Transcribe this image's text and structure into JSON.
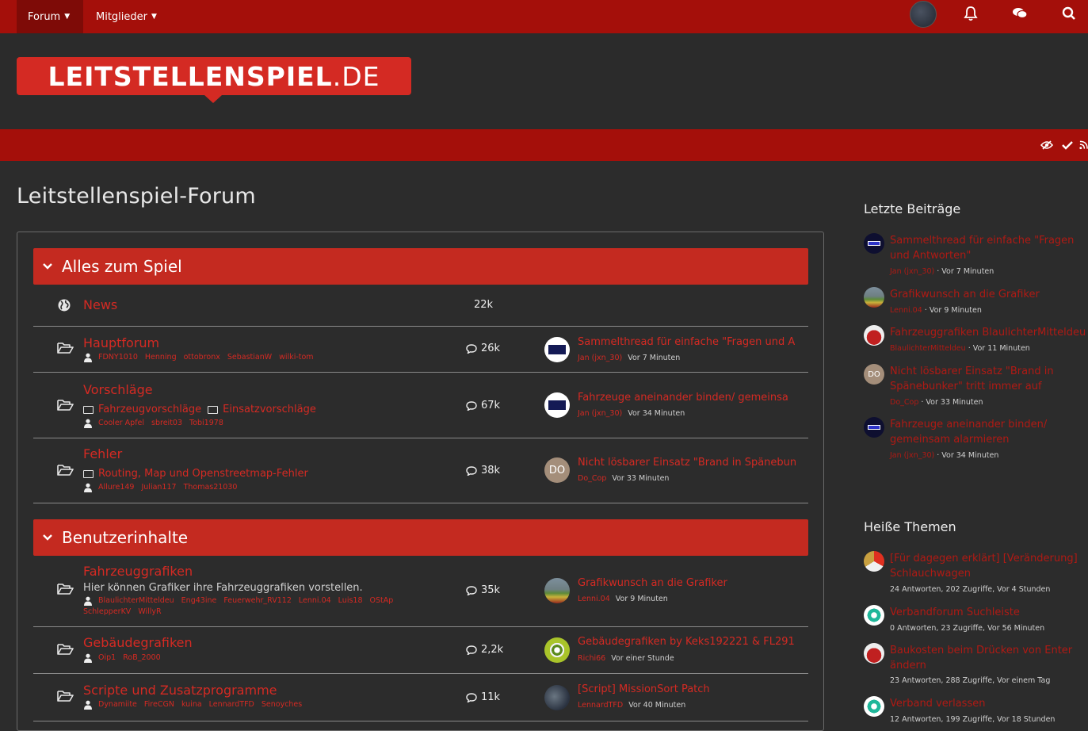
{
  "topnav": {
    "forum": "Forum",
    "members": "Mitglieder"
  },
  "logo": {
    "name": "LEITSTELLENSPIEL",
    "tld": ".DE"
  },
  "page_title": "Leitstellenspiel-Forum",
  "categories": [
    {
      "title": "Alles zum Spiel"
    },
    {
      "title": "Benutzerinhalte"
    }
  ],
  "forums": [
    {
      "title": "News",
      "count": "22k"
    },
    {
      "title": "Hauptforum",
      "mods": [
        "FDNY1010",
        "Henning",
        "ottobronx",
        "SebastianW",
        "wilki-tom"
      ],
      "count": "26k",
      "last_title": "Sammelthread für einfache \"Fragen und A",
      "last_user": "Jan (jxn_30)",
      "last_time": "Vor 7 Minuten"
    },
    {
      "title": "Vorschläge",
      "subs": [
        "Fahrzeugvorschläge",
        "Einsatzvorschläge"
      ],
      "mods": [
        "Cooler Apfel",
        "sbreit03",
        "Tobi1978"
      ],
      "count": "67k",
      "last_title": "Fahrzeuge aneinander binden/ gemeinsa",
      "last_user": "Jan (jxn_30)",
      "last_time": "Vor 34 Minuten"
    },
    {
      "title": "Fehler",
      "subs": [
        "Routing, Map und Openstreetmap-Fehler"
      ],
      "mods": [
        "Allure149",
        "Julian117",
        "Thomas21030"
      ],
      "count": "38k",
      "last_title": "Nicht lösbarer Einsatz \"Brand in Spänebun",
      "last_user": "Do_Cop",
      "last_time": "Vor 33 Minuten",
      "last_avatar": "DO"
    },
    {
      "title": "Fahrzeuggrafiken",
      "desc": "Hier können Grafiker ihre Fahrzeuggrafiken vorstellen.",
      "mods": [
        "BlaulichterMitteldeu",
        "Eng43ine",
        "Feuerwehr_RV112",
        "Lenni.04",
        "Luis18",
        "OStAp",
        "SchlepperKV",
        "WillyR"
      ],
      "count": "35k",
      "last_title": "Grafikwunsch an die Grafiker",
      "last_user": "Lenni.04",
      "last_time": "Vor 9 Minuten"
    },
    {
      "title": "Gebäudegrafiken",
      "mods": [
        "Oip1",
        "RoB_2000"
      ],
      "count": "2,2k",
      "last_title": "Gebäudegrafiken by Keks192221 & FL291",
      "last_user": "Richi66",
      "last_time": "Vor einer Stunde"
    },
    {
      "title": "Scripte und Zusatzprogramme",
      "mods": [
        "Dynamiite",
        "FireCGN",
        "kuina",
        "LennardTFD",
        "Senoyches"
      ],
      "count": "11k",
      "last_title": "[Script] MissionSort Patch",
      "last_user": "LennardTFD",
      "last_time": "Vor 40 Minuten"
    }
  ],
  "sidebar": {
    "recent_heading": "Letzte Beiträge",
    "recent": [
      {
        "title": "Sammelthread für einfache \"Fragen und Antworten\"",
        "user": "Jan (jxn_30)",
        "time": "Vor 7 Minuten"
      },
      {
        "title": "Grafikwunsch an die Grafiker",
        "user": "Lenni.04",
        "time": "Vor 9 Minuten"
      },
      {
        "title": "Fahrzeuggrafiken BlaulichterMitteldeu",
        "user": "BlaulichterMitteldeu",
        "time": "Vor 11 Minuten"
      },
      {
        "title": "Nicht lösbarer Einsatz \"Brand in Spänebunker\" tritt immer auf",
        "user": "Do_Cop",
        "time": "Vor 33 Minuten",
        "avatar": "DO"
      },
      {
        "title": "Fahrzeuge aneinander binden/ gemeinsam alarmieren",
        "user": "Jan (jxn_30)",
        "time": "Vor 34 Minuten"
      }
    ],
    "hot_heading": "Heiße Themen",
    "hot": [
      {
        "title": "[Für dagegen erklärt] [Veränderung] Schlauchwagen",
        "meta": "24 Antworten, 202 Zugriffe, Vor 4 Stunden"
      },
      {
        "title": "Verbandforum Suchleiste",
        "meta": "0 Antworten, 23 Zugriffe, Vor 56 Minuten"
      },
      {
        "title": "Baukosten beim Drücken von Enter ändern",
        "meta": "23 Antworten, 288 Zugriffe, Vor einem Tag"
      },
      {
        "title": "Verband verlassen",
        "meta": "12 Antworten, 199 Zugriffe, Vor 18 Stunden"
      }
    ]
  },
  "meta_separator": " · "
}
